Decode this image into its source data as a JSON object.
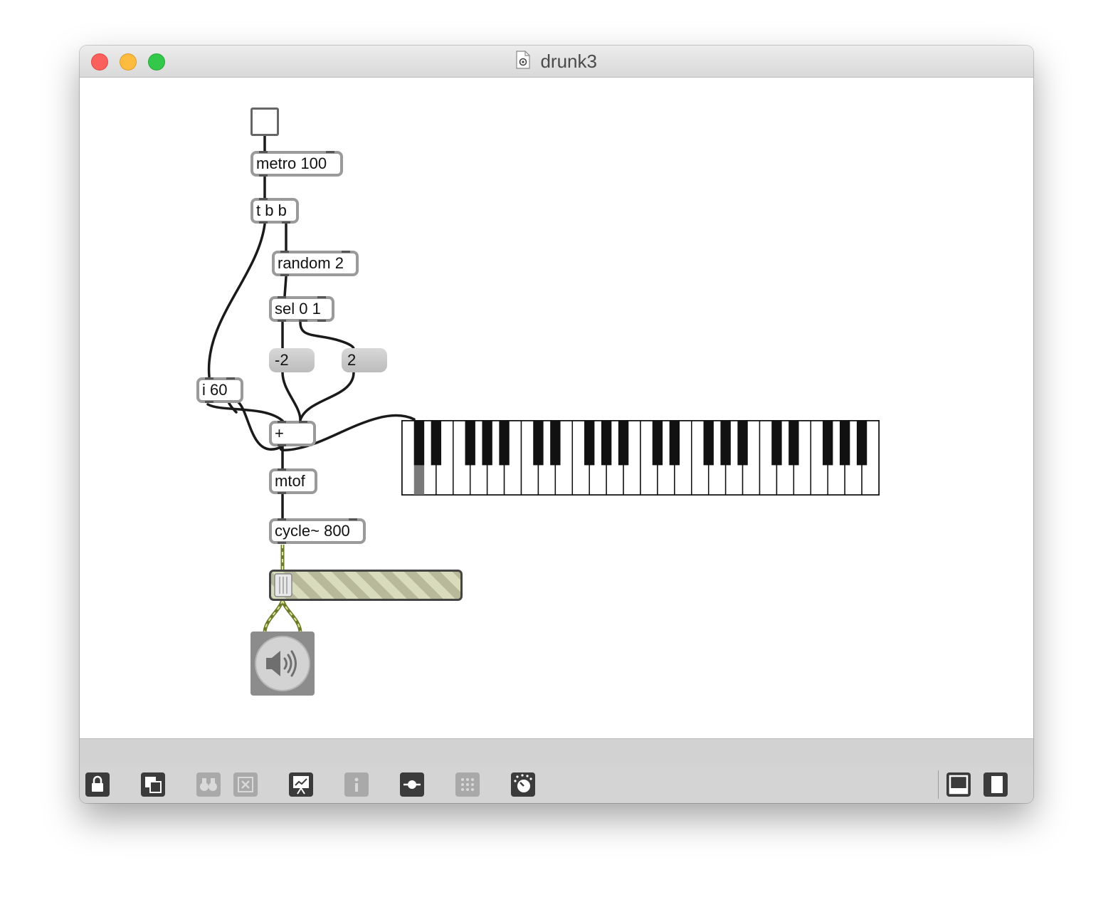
{
  "window": {
    "title": "drunk3"
  },
  "patch": {
    "metro": "metro 100",
    "trigger": "t b b",
    "random": "random 2",
    "sel": "sel 0 1",
    "msg_neg": "-2",
    "msg_pos": "2",
    "int_box": "i 60",
    "plus": "+",
    "mtof": "mtof",
    "cycle": "cycle~ 800"
  },
  "keyboard": {
    "octaves": 4,
    "active_key": "C#"
  },
  "gain": {
    "level": 0.0
  },
  "toolbar": {
    "icons": [
      "lock-icon",
      "presentation-mode-icon",
      "binoculars-icon",
      "delete-icon",
      "present-icon",
      "info-icon",
      "slider-object-icon",
      "grid-icon",
      "dsp-icon",
      "bottom-panel-icon",
      "side-panel-icon"
    ]
  }
}
